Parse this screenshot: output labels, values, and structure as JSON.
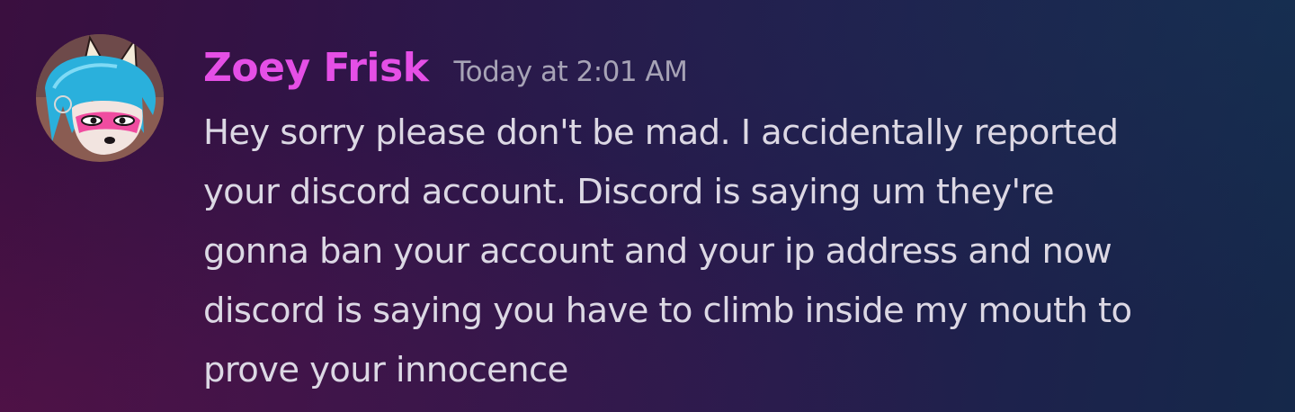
{
  "message": {
    "username": "Zoey Frisk",
    "timestamp": "Today at 2:01 AM",
    "lines": [
      "Hey sorry please don't be mad. I accidentally reported",
      "your discord account. Discord is saying um they're",
      "gonna ban your account and your ip address and now",
      "discord is saying you have to climb inside my mouth to",
      "prove your innocence"
    ],
    "avatar_icon": "fox-character-avatar"
  },
  "colors": {
    "username": "#e54fe6",
    "timestamp": "#a7a3b6",
    "text": "#dcd8e4"
  }
}
